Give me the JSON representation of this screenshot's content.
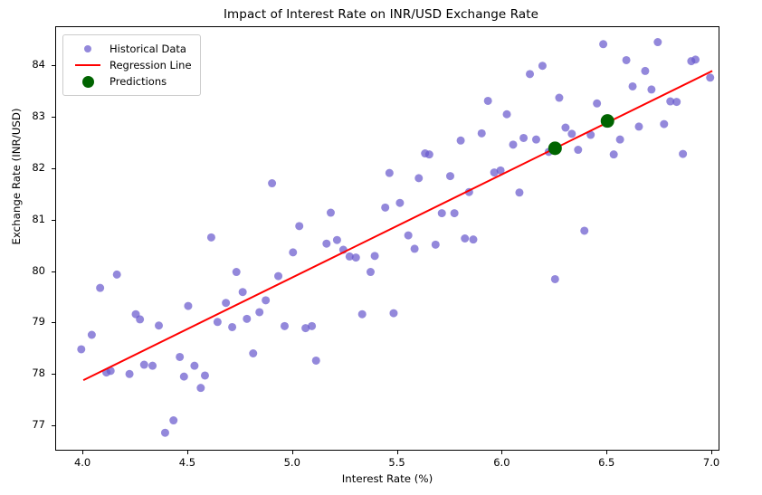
{
  "chart_data": {
    "type": "scatter",
    "title": "Impact of Interest Rate on INR/USD Exchange Rate",
    "xlabel": "Interest Rate (%)",
    "ylabel": "Exchange Rate (INR/USD)",
    "xlim": [
      3.87,
      7.03
    ],
    "ylim": [
      76.55,
      84.75
    ],
    "xticks": [
      4.0,
      4.5,
      5.0,
      5.5,
      6.0,
      6.5,
      7.0
    ],
    "xticklabels": [
      "4.0",
      "4.5",
      "5.0",
      "5.5",
      "6.0",
      "6.5",
      "7.0"
    ],
    "yticks": [
      77,
      78,
      79,
      80,
      81,
      82,
      83,
      84
    ],
    "yticklabels": [
      "77",
      "78",
      "79",
      "80",
      "81",
      "82",
      "83",
      "84"
    ],
    "grid": false,
    "legend_position": "upper left",
    "colors": {
      "historical": "#6a5acd",
      "regression": "#ff0000",
      "predictions": "#006400",
      "axes": "#000000",
      "background": "#ffffff"
    },
    "series": [
      {
        "name": "Historical Data",
        "type": "scatter",
        "marker": "circle",
        "color": "#6a5acd",
        "opacity": 0.72,
        "size": 9,
        "points": [
          [
            3.99,
            78.5
          ],
          [
            4.04,
            78.78
          ],
          [
            4.08,
            79.69
          ],
          [
            4.11,
            78.05
          ],
          [
            4.13,
            78.08
          ],
          [
            4.16,
            79.95
          ],
          [
            4.22,
            78.02
          ],
          [
            4.25,
            79.18
          ],
          [
            4.27,
            79.08
          ],
          [
            4.29,
            78.2
          ],
          [
            4.33,
            78.18
          ],
          [
            4.36,
            78.96
          ],
          [
            4.39,
            76.88
          ],
          [
            4.43,
            77.12
          ],
          [
            4.46,
            78.35
          ],
          [
            4.48,
            77.97
          ],
          [
            4.5,
            79.34
          ],
          [
            4.53,
            78.18
          ],
          [
            4.56,
            77.75
          ],
          [
            4.58,
            77.99
          ],
          [
            4.61,
            80.67
          ],
          [
            4.64,
            79.03
          ],
          [
            4.68,
            79.4
          ],
          [
            4.71,
            78.93
          ],
          [
            4.73,
            80.0
          ],
          [
            4.76,
            79.61
          ],
          [
            4.78,
            79.09
          ],
          [
            4.81,
            78.42
          ],
          [
            4.84,
            79.22
          ],
          [
            4.87,
            79.45
          ],
          [
            4.9,
            81.72
          ],
          [
            4.93,
            79.92
          ],
          [
            4.96,
            78.95
          ],
          [
            5.0,
            80.38
          ],
          [
            5.03,
            80.89
          ],
          [
            5.06,
            78.91
          ],
          [
            5.09,
            78.95
          ],
          [
            5.11,
            78.28
          ],
          [
            5.16,
            80.55
          ],
          [
            5.18,
            81.15
          ],
          [
            5.21,
            80.62
          ],
          [
            5.24,
            80.43
          ],
          [
            5.27,
            80.3
          ],
          [
            5.3,
            80.28
          ],
          [
            5.33,
            79.18
          ],
          [
            5.37,
            80.0
          ],
          [
            5.39,
            80.31
          ],
          [
            5.44,
            81.25
          ],
          [
            5.46,
            81.92
          ],
          [
            5.48,
            79.2
          ],
          [
            5.51,
            81.34
          ],
          [
            5.55,
            80.71
          ],
          [
            5.58,
            80.45
          ],
          [
            5.6,
            81.82
          ],
          [
            5.63,
            82.3
          ],
          [
            5.65,
            82.28
          ],
          [
            5.68,
            80.53
          ],
          [
            5.71,
            81.14
          ],
          [
            5.75,
            81.86
          ],
          [
            5.77,
            81.14
          ],
          [
            5.8,
            82.55
          ],
          [
            5.82,
            80.65
          ],
          [
            5.84,
            81.55
          ],
          [
            5.86,
            80.63
          ],
          [
            5.9,
            82.69
          ],
          [
            5.93,
            83.32
          ],
          [
            5.96,
            81.93
          ],
          [
            5.99,
            81.97
          ],
          [
            6.02,
            83.06
          ],
          [
            6.05,
            82.47
          ],
          [
            6.08,
            81.54
          ],
          [
            6.1,
            82.6
          ],
          [
            6.13,
            83.84
          ],
          [
            6.16,
            82.57
          ],
          [
            6.19,
            84.0
          ],
          [
            6.22,
            82.33
          ],
          [
            6.25,
            79.86
          ],
          [
            6.27,
            83.38
          ],
          [
            6.3,
            82.8
          ],
          [
            6.33,
            82.68
          ],
          [
            6.36,
            82.37
          ],
          [
            6.39,
            80.8
          ],
          [
            6.42,
            82.66
          ],
          [
            6.45,
            83.27
          ],
          [
            6.48,
            84.42
          ],
          [
            6.51,
            82.95
          ],
          [
            6.53,
            82.28
          ],
          [
            6.56,
            82.57
          ],
          [
            6.59,
            84.11
          ],
          [
            6.62,
            83.6
          ],
          [
            6.65,
            82.82
          ],
          [
            6.68,
            83.9
          ],
          [
            6.71,
            83.54
          ],
          [
            6.74,
            84.46
          ],
          [
            6.77,
            82.87
          ],
          [
            6.8,
            83.31
          ],
          [
            6.83,
            83.3
          ],
          [
            6.86,
            82.29
          ],
          [
            6.9,
            84.09
          ],
          [
            6.92,
            84.12
          ],
          [
            6.99,
            83.77
          ]
        ]
      },
      {
        "name": "Regression Line",
        "type": "line",
        "color": "#ff0000",
        "linewidth": 2,
        "points": [
          [
            4.0,
            77.9
          ],
          [
            7.0,
            83.9
          ]
        ]
      },
      {
        "name": "Predictions",
        "type": "scatter",
        "marker": "circle",
        "color": "#006400",
        "opacity": 1,
        "size": 15,
        "points": [
          [
            6.25,
            82.4
          ],
          [
            6.5,
            82.93
          ]
        ]
      }
    ],
    "legend": [
      {
        "label": "Historical Data",
        "key": "marker-dot-small",
        "color": "#6a5acd"
      },
      {
        "label": "Regression Line",
        "key": "line-segment",
        "color": "#ff0000"
      },
      {
        "label": "Predictions",
        "key": "marker-dot-large",
        "color": "#006400"
      }
    ]
  }
}
